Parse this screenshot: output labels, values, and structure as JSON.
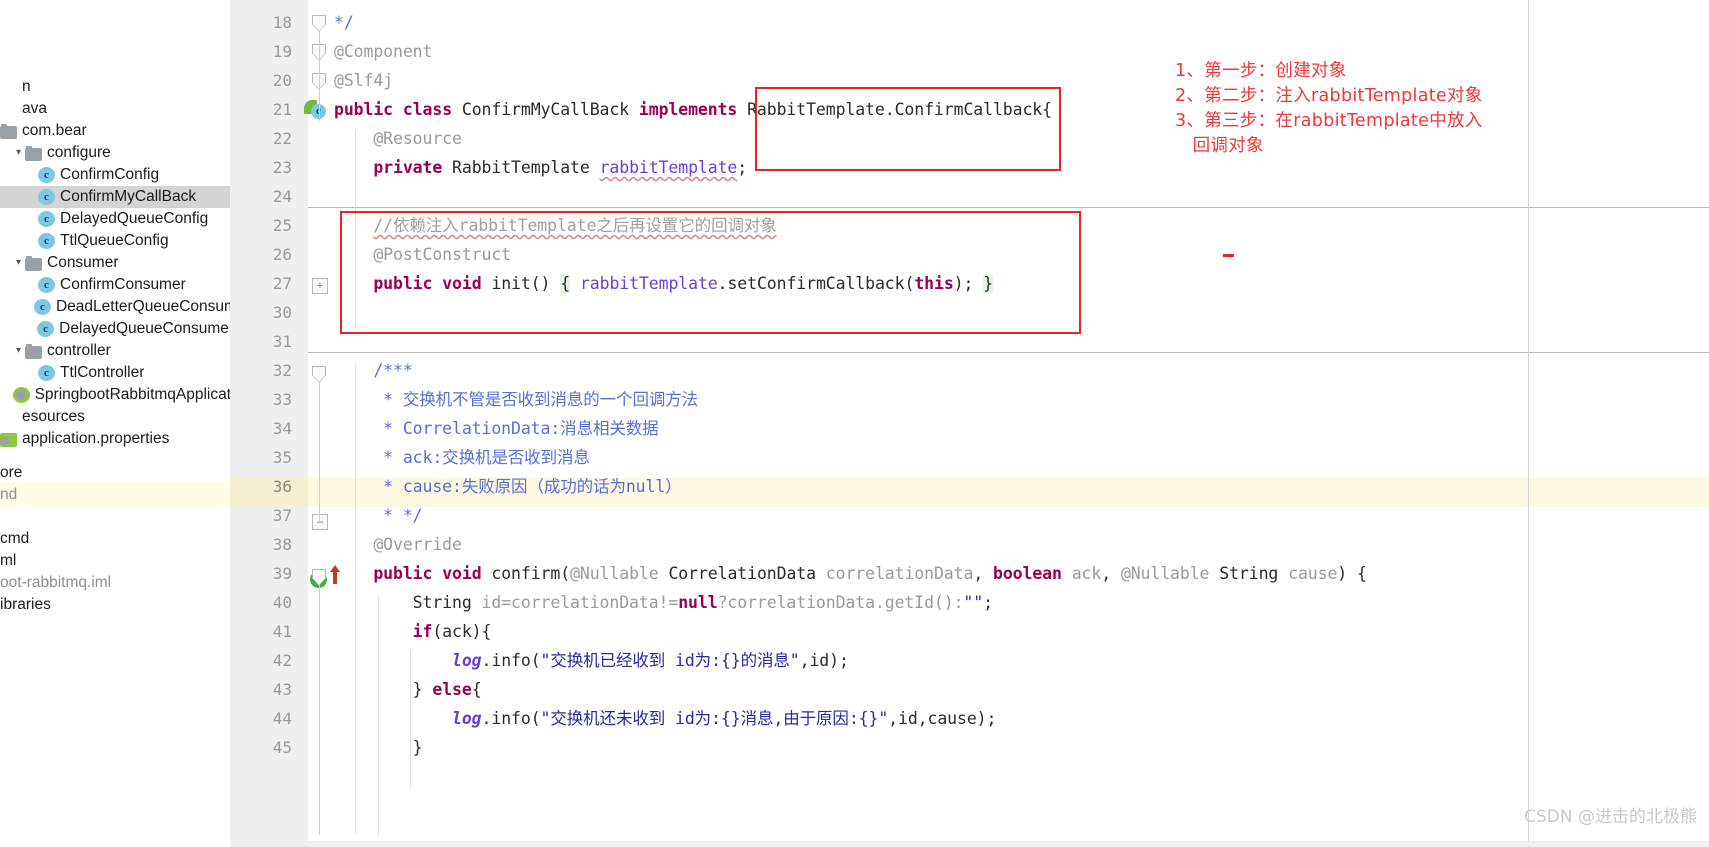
{
  "sidebar": {
    "items": [
      {
        "label": "n",
        "indent": 0,
        "arrow": "",
        "icon": "none",
        "dim": false,
        "selected": false
      },
      {
        "label": "ava",
        "indent": 0,
        "arrow": "",
        "icon": "none",
        "dim": false,
        "selected": false
      },
      {
        "label": "com.bear",
        "indent": 0,
        "arrow": "",
        "icon": "folder",
        "dim": false,
        "selected": false
      },
      {
        "label": "configure",
        "indent": 12,
        "arrow": "v",
        "icon": "folder",
        "dim": false,
        "selected": false
      },
      {
        "label": "ConfirmConfig",
        "indent": 38,
        "arrow": "",
        "icon": "class",
        "dim": false,
        "selected": false
      },
      {
        "label": "ConfirmMyCallBack",
        "indent": 38,
        "arrow": "",
        "icon": "class",
        "dim": false,
        "selected": true
      },
      {
        "label": "DelayedQueueConfig",
        "indent": 38,
        "arrow": "",
        "icon": "class",
        "dim": false,
        "selected": false
      },
      {
        "label": "TtlQueueConfig",
        "indent": 38,
        "arrow": "",
        "icon": "class",
        "dim": false,
        "selected": false
      },
      {
        "label": "Consumer",
        "indent": 12,
        "arrow": "v",
        "icon": "folder",
        "dim": false,
        "selected": false
      },
      {
        "label": "ConfirmConsumer",
        "indent": 38,
        "arrow": "",
        "icon": "class",
        "dim": false,
        "selected": false
      },
      {
        "label": "DeadLetterQueueConsumer",
        "indent": 38,
        "arrow": "",
        "icon": "class",
        "dim": false,
        "selected": false
      },
      {
        "label": "DelayedQueueConsumer",
        "indent": 38,
        "arrow": "",
        "icon": "class",
        "dim": false,
        "selected": false
      },
      {
        "label": "controller",
        "indent": 12,
        "arrow": "v",
        "icon": "folder",
        "dim": false,
        "selected": false
      },
      {
        "label": "TtlController",
        "indent": 38,
        "arrow": "",
        "icon": "class",
        "dim": false,
        "selected": false
      },
      {
        "label": "SpringbootRabbitmqApplication",
        "indent": 14,
        "arrow": "",
        "icon": "spring",
        "dim": false,
        "selected": false
      },
      {
        "label": "esources",
        "indent": 0,
        "arrow": "",
        "icon": "none",
        "dim": false,
        "selected": false
      },
      {
        "label": "application.properties",
        "indent": 0,
        "arrow": "",
        "icon": "props",
        "dim": false,
        "selected": false
      }
    ],
    "items_lower": [
      {
        "label": "ore",
        "dim": false
      },
      {
        "label": "nd",
        "dim": true
      },
      {
        "label": "",
        "dim": false
      },
      {
        "label": "cmd",
        "dim": false
      },
      {
        "label": "ml",
        "dim": false
      },
      {
        "label": "oot-rabbitmq.iml",
        "dim": true
      },
      {
        "label": "ibraries",
        "dim": false
      }
    ]
  },
  "editor": {
    "line_numbers": [
      "18",
      "19",
      "20",
      "21",
      "22",
      "23",
      "24",
      "25",
      "26",
      "27",
      "30",
      "31",
      "32",
      "33",
      "34",
      "35",
      "36",
      "37",
      "38",
      "39",
      "40",
      "41",
      "42",
      "43",
      "44",
      "45"
    ],
    "highlighted_line": "36",
    "gutter_class_icon": "class-marker-icon",
    "gutter_impl_icon": "implementing-method-icon",
    "lines": [
      {
        "n": "18",
        "plain": "*/"
      },
      {
        "n": "19",
        "plain": "@Component"
      },
      {
        "n": "20",
        "plain": "@Slf4j"
      },
      {
        "n": "21",
        "plain": "public class ConfirmMyCallBack implements RabbitTemplate.ConfirmCallback{"
      },
      {
        "n": "22",
        "plain": "    @Resource"
      },
      {
        "n": "23",
        "plain": "    private RabbitTemplate rabbitTemplate;"
      },
      {
        "n": "24",
        "plain": ""
      },
      {
        "n": "25",
        "plain": "    //依赖注入rabbitTemplate之后再设置它的回调对象"
      },
      {
        "n": "26",
        "plain": "    @PostConstruct"
      },
      {
        "n": "27",
        "plain": "    public void init() { rabbitTemplate.setConfirmCallback(this); }"
      },
      {
        "n": "30",
        "plain": ""
      },
      {
        "n": "31",
        "plain": ""
      },
      {
        "n": "32",
        "plain": "    /***"
      },
      {
        "n": "33",
        "plain": "     * 交换机不管是否收到消息的一个回调方法"
      },
      {
        "n": "34",
        "plain": "     * CorrelationData:消息相关数据"
      },
      {
        "n": "35",
        "plain": "     * ack:交换机是否收到消息"
      },
      {
        "n": "36",
        "plain": "     * cause:失败原因（成功的话为null）"
      },
      {
        "n": "37",
        "plain": "     * */"
      },
      {
        "n": "38",
        "plain": "    @Override"
      },
      {
        "n": "39",
        "plain": "    public void confirm(@Nullable CorrelationData correlationData, boolean ack, @Nullable String cause) {"
      },
      {
        "n": "40",
        "plain": "        String id=correlationData!=null?correlationData.getId():\"\";"
      },
      {
        "n": "41",
        "plain": "        if(ack){"
      },
      {
        "n": "42",
        "plain": "            log.info(\"交换机已经收到 id为:{}的消息\",id);"
      },
      {
        "n": "43",
        "plain": "        } else{"
      },
      {
        "n": "44",
        "plain": "            log.info(\"交换机还未收到 id为:{}消息,由于原因:{}\",id,cause);"
      },
      {
        "n": "45",
        "plain": "        }"
      }
    ],
    "tokens": {
      "l18_comment": "*/",
      "l19_annotation": "@Component",
      "l20_annotation": "@Slf4j",
      "l21_kw_public": "public",
      "l21_kw_class": "class",
      "l21_name": "ConfirmMyCallBack",
      "l21_kw_implements": "implements",
      "l21_iface": "RabbitTemplate.ConfirmCallback",
      "l21_brace": "{",
      "l22_annotation": "@Resource",
      "l23_kw_private": "private",
      "l23_type": "RabbitTemplate",
      "l23_field": "rabbitTemplate",
      "l23_semi": ";",
      "l25_comment": "//依赖注入rabbitTemplate之后再设置它的回调对象",
      "l26_annotation": "@PostConstruct",
      "l27_kw_public": "public",
      "l27_kw_void": "void",
      "l27_method": "init()",
      "l27_open": "{",
      "l27_field": "rabbitTemplate",
      "l27_call": ".setConfirmCallback(",
      "l27_kw_this": "this",
      "l27_tail": ");",
      "l27_close": "}",
      "l32_jdoc": "/***",
      "l33_jdoc": "* 交换机不管是否收到消息的一个回调方法",
      "l34_jdoc": "* CorrelationData:消息相关数据",
      "l35_jdoc": "* ack:交换机是否收到消息",
      "l36_jdoc": "* cause:失败原因（成功的话为null）",
      "l37_jdoc": "* */",
      "l38_annotation": "@Override",
      "l39_kw_public": "public",
      "l39_kw_void": "void",
      "l39_method": "confirm",
      "l39_p1_ann": "@Nullable",
      "l39_p1_type": "CorrelationData",
      "l39_p1_name": "correlationData",
      "l39_kw_boolean": "boolean",
      "l39_p2_name": "ack",
      "l39_p3_ann": "@Nullable",
      "l39_p3_type": "String",
      "l39_p3_name": "cause",
      "l40_type": "String",
      "l40_expr_a": "id=correlationData!=",
      "l40_kw_null": "null",
      "l40_expr_b": "?correlationData.getId():",
      "l40_str": "\"\"",
      "l40_semi": ";",
      "l41_kw_if": "if",
      "l41_cond": "(ack){",
      "l42_log": "log",
      "l42_info": ".info(",
      "l42_str": "\"交换机已经收到 id为:{}的消息\"",
      "l42_args": ",id);",
      "l43_close": "}",
      "l43_kw_else": "else",
      "l43_open": "{",
      "l44_log": "log",
      "l44_info": ".info(",
      "l44_str": "\"交换机还未收到 id为:{}消息,由于原因:{}\"",
      "l44_args": ",id,cause);",
      "l45_close": "}"
    }
  },
  "annotations": {
    "steps_text": "1、第一步：创建对象\n2、第二步：注入rabbitTemplate对象\n3、第三步：在rabbitTemplate中放入\n   回调对象",
    "color": "#f0373a",
    "box_color": "#ee2222"
  },
  "watermark": {
    "text": "CSDN @进击的北极熊"
  }
}
